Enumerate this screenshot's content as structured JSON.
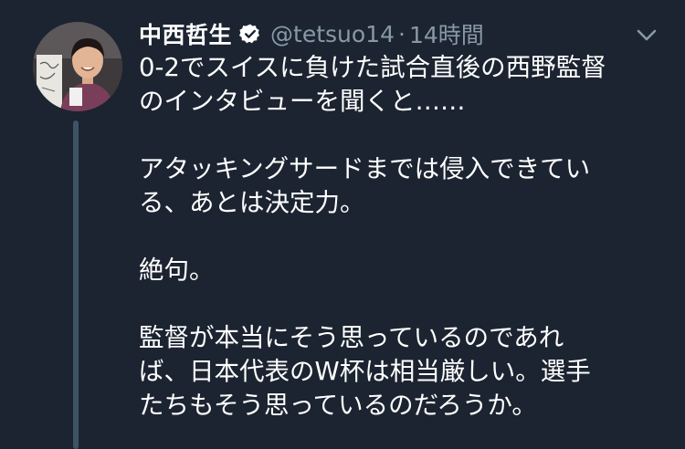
{
  "tweet": {
    "author_name": "中西哲生",
    "handle": "@tetsuo14",
    "separator": "·",
    "time": "14時間",
    "lines": [
      "0-2でスイスに負けた試合直後の西野監督",
      "のインタビューを聞くと……",
      "",
      "アタッキングサードまでは侵入できてい",
      "る、あとは決定力。",
      "",
      "絶句。",
      "",
      "監督が本当にそう思っているのであれ",
      "ば、日本代表のW杯は相当厳しい。選手",
      "たちもそう思っているのだろうか。"
    ]
  },
  "colors": {
    "background": "#1c2431",
    "secondary_text": "#8899a6",
    "thread_line": "#3d5466"
  },
  "icons": {
    "verified": "verified-badge-icon",
    "menu": "chevron-down-icon"
  }
}
